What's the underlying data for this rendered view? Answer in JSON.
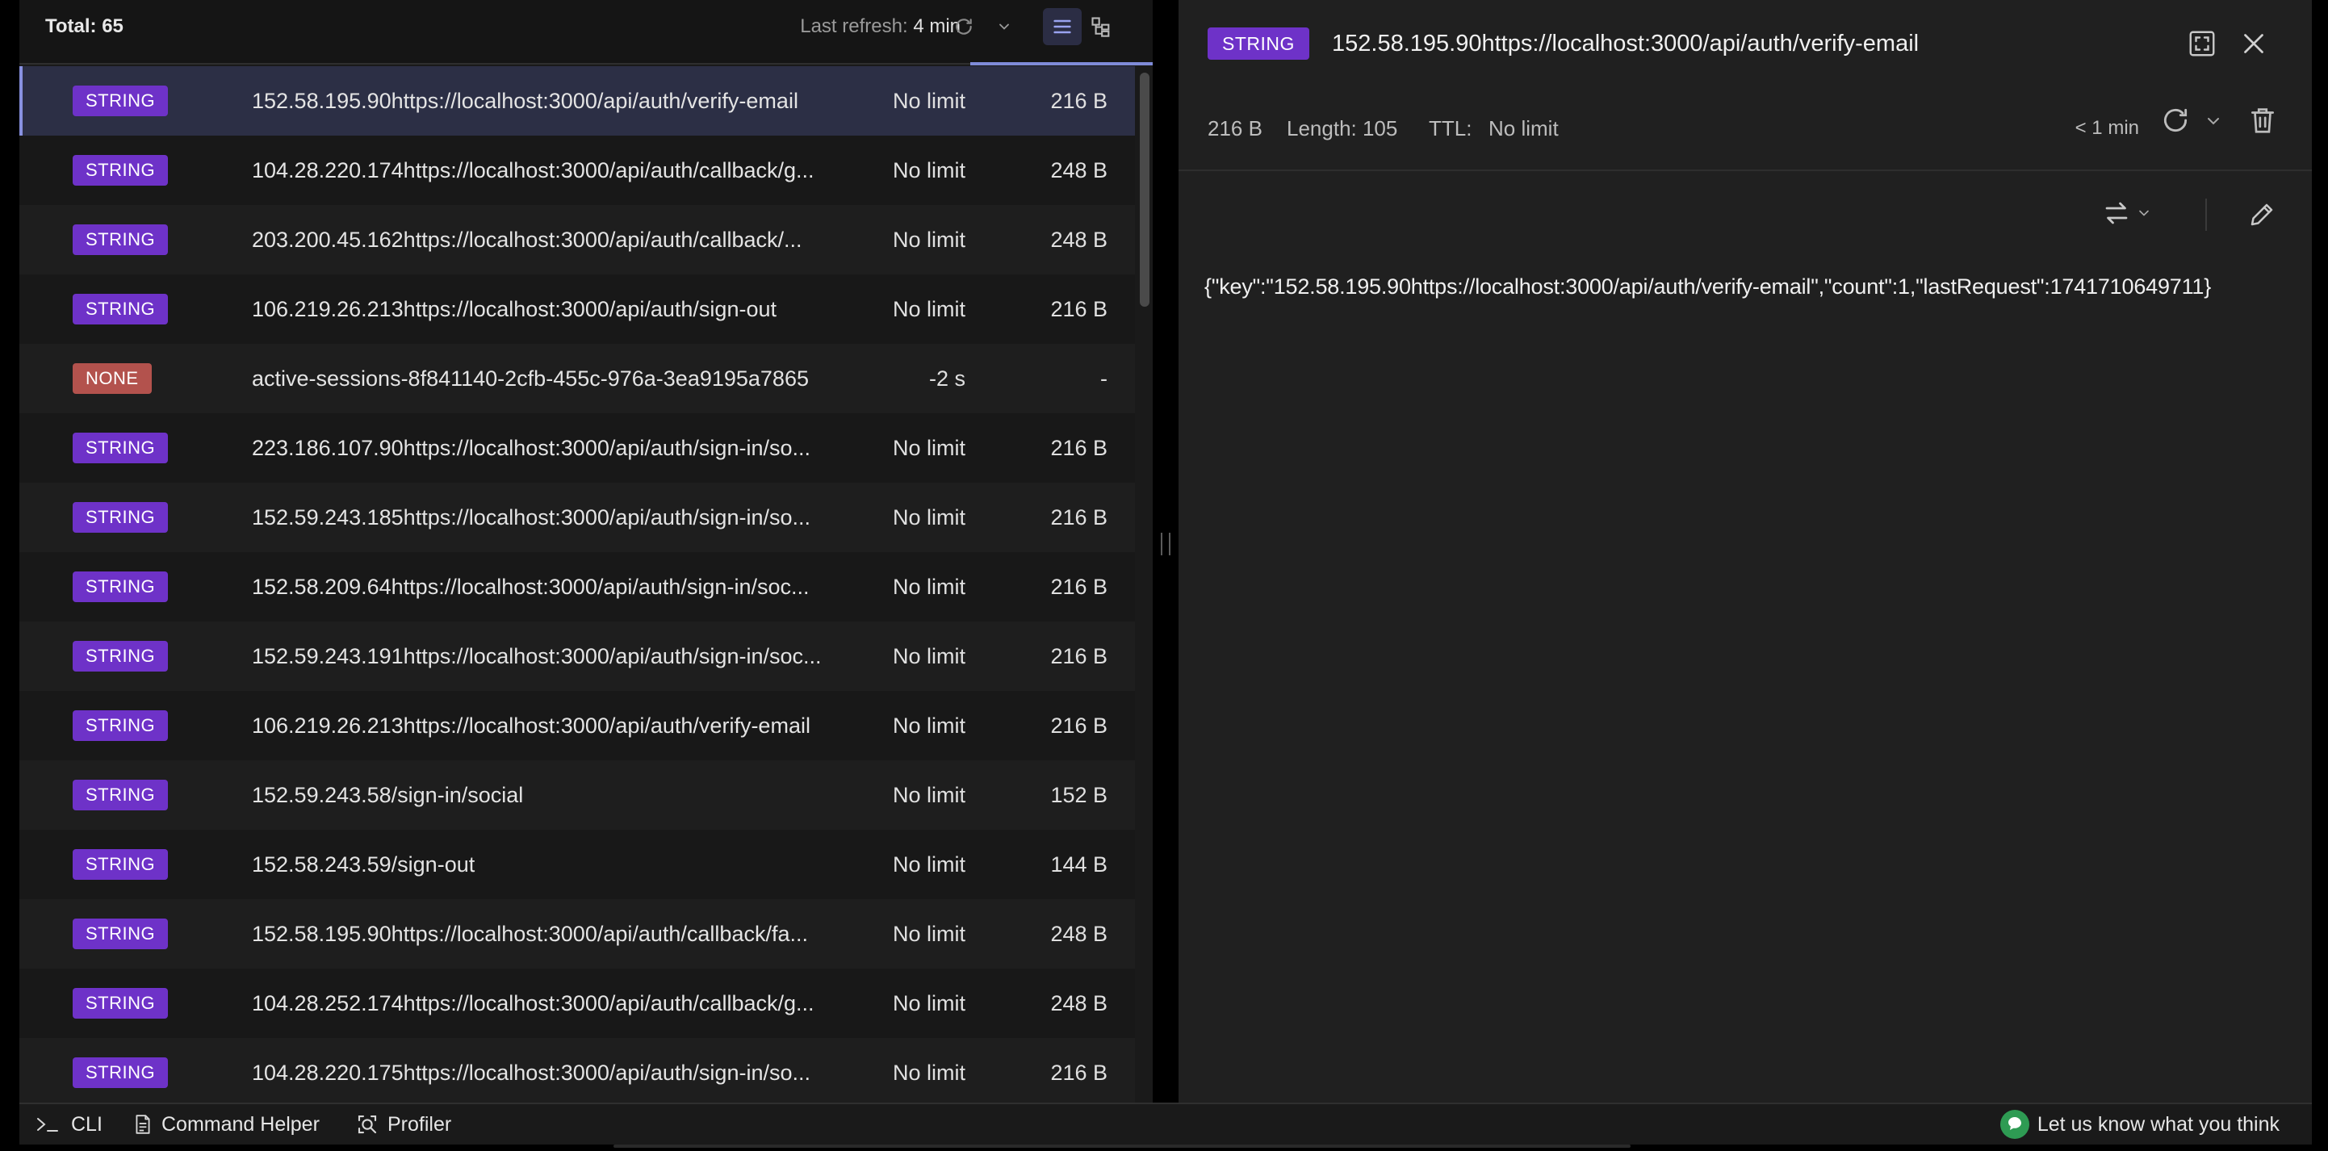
{
  "header": {
    "total": "Total: 65",
    "last_refresh_label": "Last refresh:",
    "last_refresh_value": "4 min"
  },
  "keys": [
    {
      "type": "STRING",
      "name": "152.58.195.90https://localhost:3000/api/auth/verify-email",
      "ttl": "No limit",
      "size": "216 B",
      "selected": true
    },
    {
      "type": "STRING",
      "name": "104.28.220.174https://localhost:3000/api/auth/callback/g...",
      "ttl": "No limit",
      "size": "248 B"
    },
    {
      "type": "STRING",
      "name": "203.200.45.162https://localhost:3000/api/auth/callback/...",
      "ttl": "No limit",
      "size": "248 B"
    },
    {
      "type": "STRING",
      "name": "106.219.26.213https://localhost:3000/api/auth/sign-out",
      "ttl": "No limit",
      "size": "216 B"
    },
    {
      "type": "NONE",
      "name": "active-sessions-8f841140-2cfb-455c-976a-3ea9195a7865",
      "ttl": "-2 s",
      "size": "-"
    },
    {
      "type": "STRING",
      "name": "223.186.107.90https://localhost:3000/api/auth/sign-in/so...",
      "ttl": "No limit",
      "size": "216 B"
    },
    {
      "type": "STRING",
      "name": "152.59.243.185https://localhost:3000/api/auth/sign-in/so...",
      "ttl": "No limit",
      "size": "216 B"
    },
    {
      "type": "STRING",
      "name": "152.58.209.64https://localhost:3000/api/auth/sign-in/soc...",
      "ttl": "No limit",
      "size": "216 B"
    },
    {
      "type": "STRING",
      "name": "152.59.243.191https://localhost:3000/api/auth/sign-in/soc...",
      "ttl": "No limit",
      "size": "216 B"
    },
    {
      "type": "STRING",
      "name": "106.219.26.213https://localhost:3000/api/auth/verify-email",
      "ttl": "No limit",
      "size": "216 B"
    },
    {
      "type": "STRING",
      "name": "152.59.243.58/sign-in/social",
      "ttl": "No limit",
      "size": "152 B"
    },
    {
      "type": "STRING",
      "name": "152.58.243.59/sign-out",
      "ttl": "No limit",
      "size": "144 B"
    },
    {
      "type": "STRING",
      "name": "152.58.195.90https://localhost:3000/api/auth/callback/fa...",
      "ttl": "No limit",
      "size": "248 B"
    },
    {
      "type": "STRING",
      "name": "104.28.252.174https://localhost:3000/api/auth/callback/g...",
      "ttl": "No limit",
      "size": "248 B"
    },
    {
      "type": "STRING",
      "name": "104.28.220.175https://localhost:3000/api/auth/sign-in/so...",
      "ttl": "No limit",
      "size": "216 B"
    }
  ],
  "detail": {
    "type": "STRING",
    "key": "152.58.195.90https://localhost:3000/api/auth/verify-email",
    "size": "216 B",
    "length": "Length: 105",
    "ttl_label": "TTL:",
    "ttl_value": "No limit",
    "refresh_time": "< 1 min",
    "value": "{\"key\":\"152.58.195.90https://localhost:3000/api/auth/verify-email\",\"count\":1,\"lastRequest\":1741710649711}"
  },
  "bottom_bar": {
    "cli": "CLI",
    "command_helper": "Command Helper",
    "profiler": "Profiler",
    "feedback": "Let us know what you think"
  },
  "colors": {
    "string_badge": "#6e32c8",
    "none_badge": "#b3524d",
    "selected_row": "#2c2f45",
    "accent": "#8891e0",
    "feedback_icon": "#2e9b53"
  },
  "icons": [
    "refresh-icon",
    "chevron-down-icon",
    "list-view-icon",
    "tree-view-icon",
    "fullscreen-icon",
    "close-icon",
    "delete-icon",
    "format-switch-icon",
    "edit-icon",
    "terminal-icon",
    "document-icon",
    "profiler-icon",
    "feedback-icon"
  ]
}
